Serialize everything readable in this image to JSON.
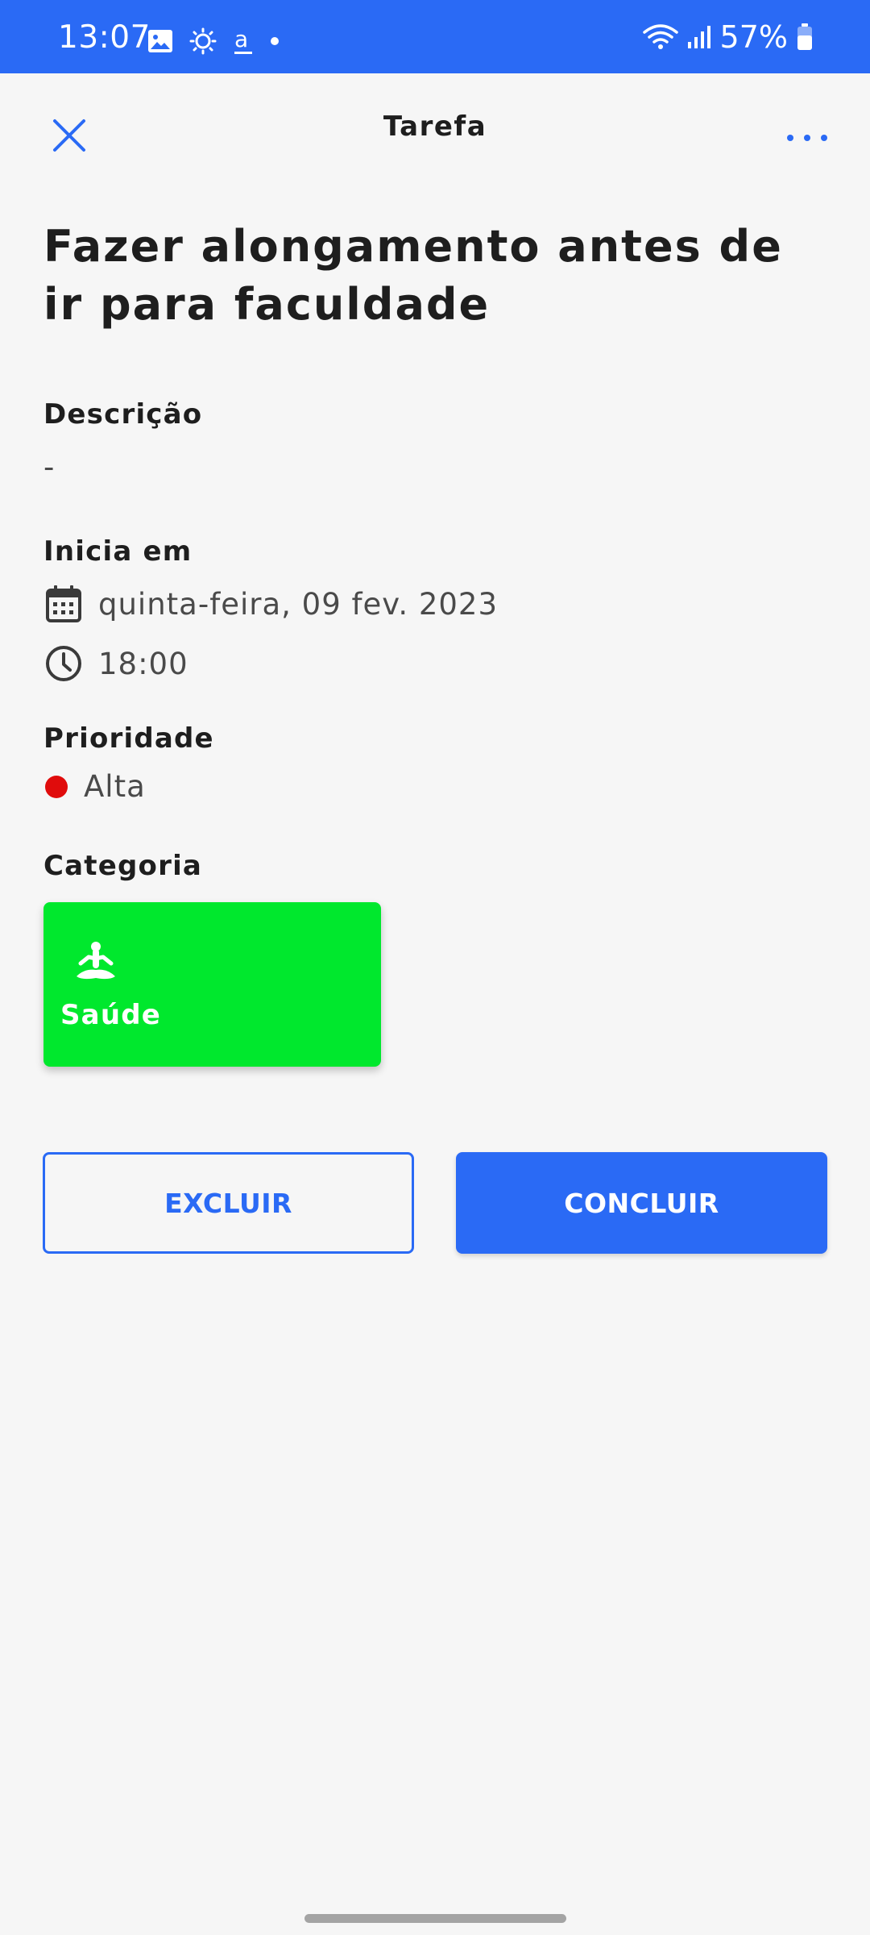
{
  "status_bar": {
    "time": "13:07",
    "battery": "57%",
    "icons_left": [
      "image-icon",
      "brightness-icon",
      "amazon-icon",
      "dot-icon"
    ],
    "icons_right": [
      "wifi-icon",
      "signal-icon",
      "battery-icon"
    ]
  },
  "app_bar": {
    "title": "Tarefa",
    "close_icon": "close-icon",
    "more_icon": "more-horizontal-icon"
  },
  "task": {
    "title": "Fazer alongamento antes de ir para faculdade",
    "description_label": "Descrição",
    "description_value": "-",
    "start_label": "Inicia em",
    "date": "quinta-feira, 09 fev. 2023",
    "time": "18:00",
    "priority_label": "Prioridade",
    "priority_value": "Alta",
    "category_label": "Categoria",
    "category": {
      "name": "Saúde",
      "icon": "meditation-icon",
      "color": "#00e82d"
    }
  },
  "actions": {
    "delete_label": "EXCLUIR",
    "complete_label": "CONCLUIR"
  },
  "colors": {
    "primary": "#2a6af5",
    "priority_high": "#e00c0c",
    "background": "#f6f6f6"
  }
}
